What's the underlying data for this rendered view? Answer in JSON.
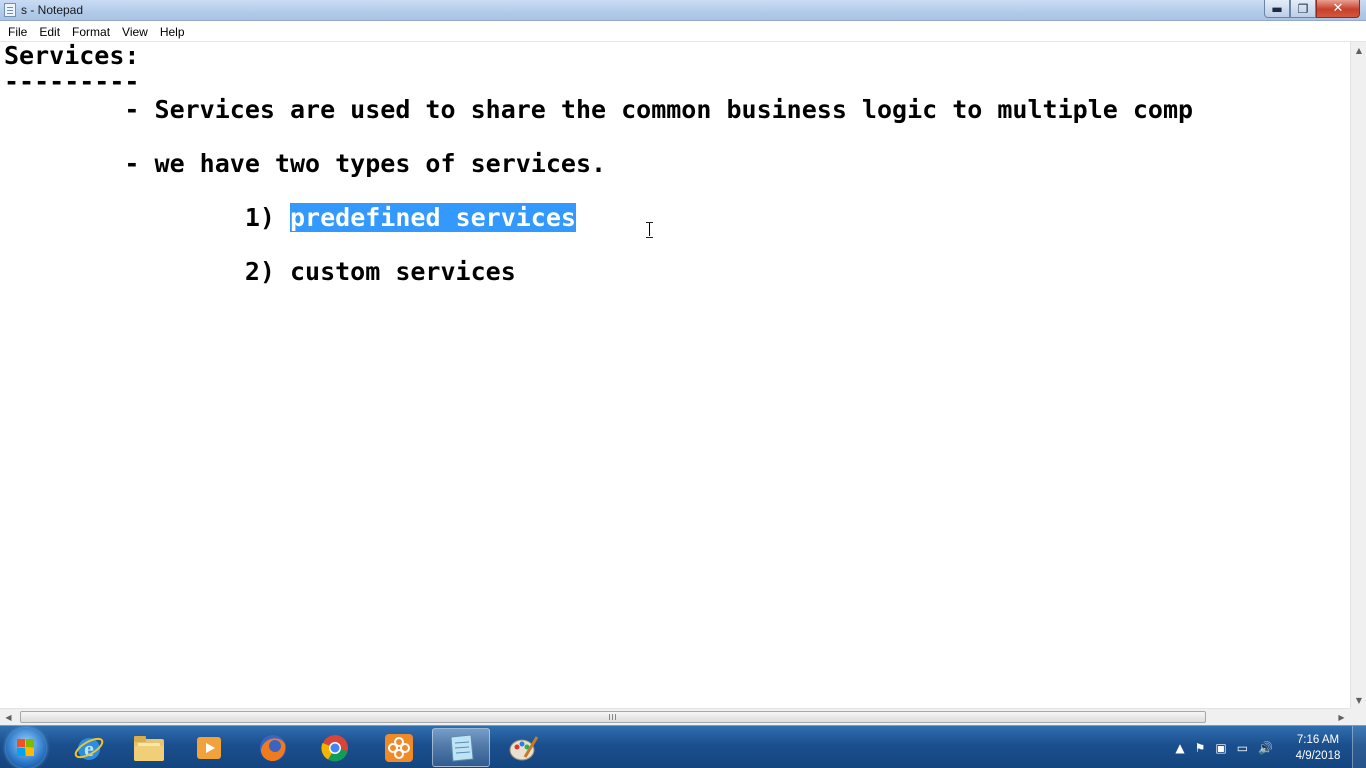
{
  "window": {
    "title": "s - Notepad",
    "minimize_glyph": "▬",
    "maximize_glyph": "❐",
    "close_glyph": "✕"
  },
  "menu": [
    "File",
    "Edit",
    "Format",
    "View",
    "Help"
  ],
  "document": {
    "line1": "Services:",
    "line2": "---------",
    "line3": "        - Services are used to share the common business logic to multiple comp",
    "line4": "        - we have two types of services.",
    "line5_prefix": "                1) ",
    "line5_selected": "predefined services",
    "line6": "                2) custom services"
  },
  "taskbar": {
    "apps": [
      {
        "name": "internet-explorer"
      },
      {
        "name": "file-explorer"
      },
      {
        "name": "media-player"
      },
      {
        "name": "firefox"
      },
      {
        "name": "chrome"
      },
      {
        "name": "app-flower"
      },
      {
        "name": "notepad",
        "active": true
      },
      {
        "name": "paint"
      }
    ],
    "tray": {
      "time": "7:16 AM",
      "date": "4/9/2018"
    }
  },
  "colors": {
    "selection": "#3399ff",
    "taskbar": "#1b4f8d"
  }
}
